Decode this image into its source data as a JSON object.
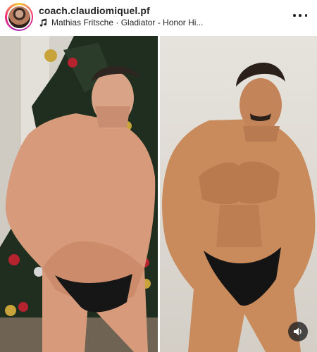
{
  "post": {
    "username": "coach.claudiomiquel.pf",
    "audio": "Mathias Fritsche · Gladiator - Honor Hi..."
  },
  "icons": {
    "avatar": "profile-avatar",
    "audio": "music-note-icon",
    "more": "more-options-icon",
    "sound": "speaker-icon"
  },
  "colors": {
    "text": "#262626",
    "ring_start": "#f9ce34",
    "ring_mid": "#ee2a7b",
    "ring_end": "#a626b8"
  }
}
